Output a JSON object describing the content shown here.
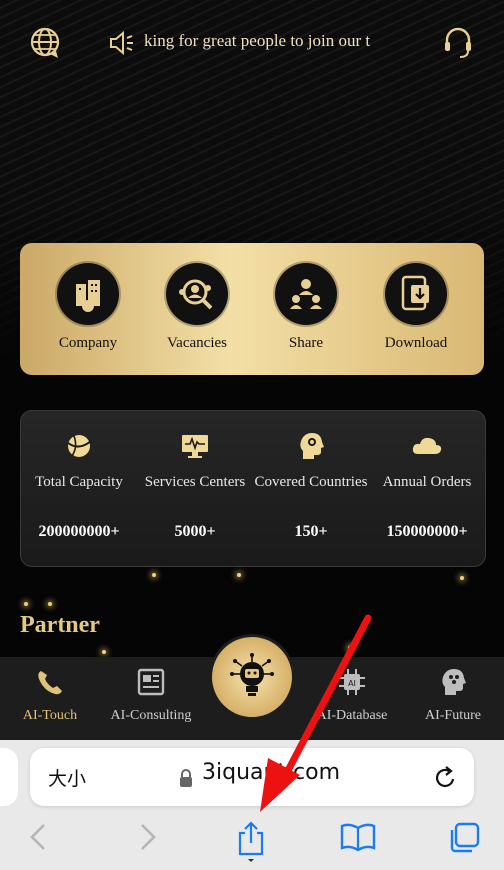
{
  "header": {
    "marquee_text": "king for great people to join our t",
    "icons": [
      "globe-chat-icon",
      "speaker-icon",
      "headset-icon"
    ]
  },
  "quick_links": [
    {
      "label": "Company",
      "icon": "company-icon"
    },
    {
      "label": "Vacancies",
      "icon": "vacancies-icon"
    },
    {
      "label": "Share",
      "icon": "share-icon"
    },
    {
      "label": "Download",
      "icon": "download-icon"
    }
  ],
  "stats": [
    {
      "label": "Total Capacity",
      "value": "200000000+",
      "icon": "planet-icon"
    },
    {
      "label": "Services Centers",
      "value": "5000+",
      "icon": "monitor-icon"
    },
    {
      "label": "Covered Countries",
      "value": "150+",
      "icon": "head-icon"
    },
    {
      "label": "Annual Orders",
      "value": "150000000+",
      "icon": "cloud-icon"
    }
  ],
  "partner_title": "Partner",
  "tabs": [
    {
      "label": "AI-Touch",
      "icon": "phone-icon",
      "active": true
    },
    {
      "label": "AI-Consulting",
      "icon": "newspaper-icon",
      "active": false
    },
    {
      "label": "AI-Database",
      "icon": "chip-icon",
      "active": false
    },
    {
      "label": "AI-Future",
      "icon": "brain-head-icon",
      "active": false
    }
  ],
  "browser": {
    "text_size_label": "大小",
    "url": "3iquant.com"
  },
  "colors": {
    "gold": "#e2c278",
    "gold_light": "#f3dfa6",
    "dark": "#111111"
  }
}
